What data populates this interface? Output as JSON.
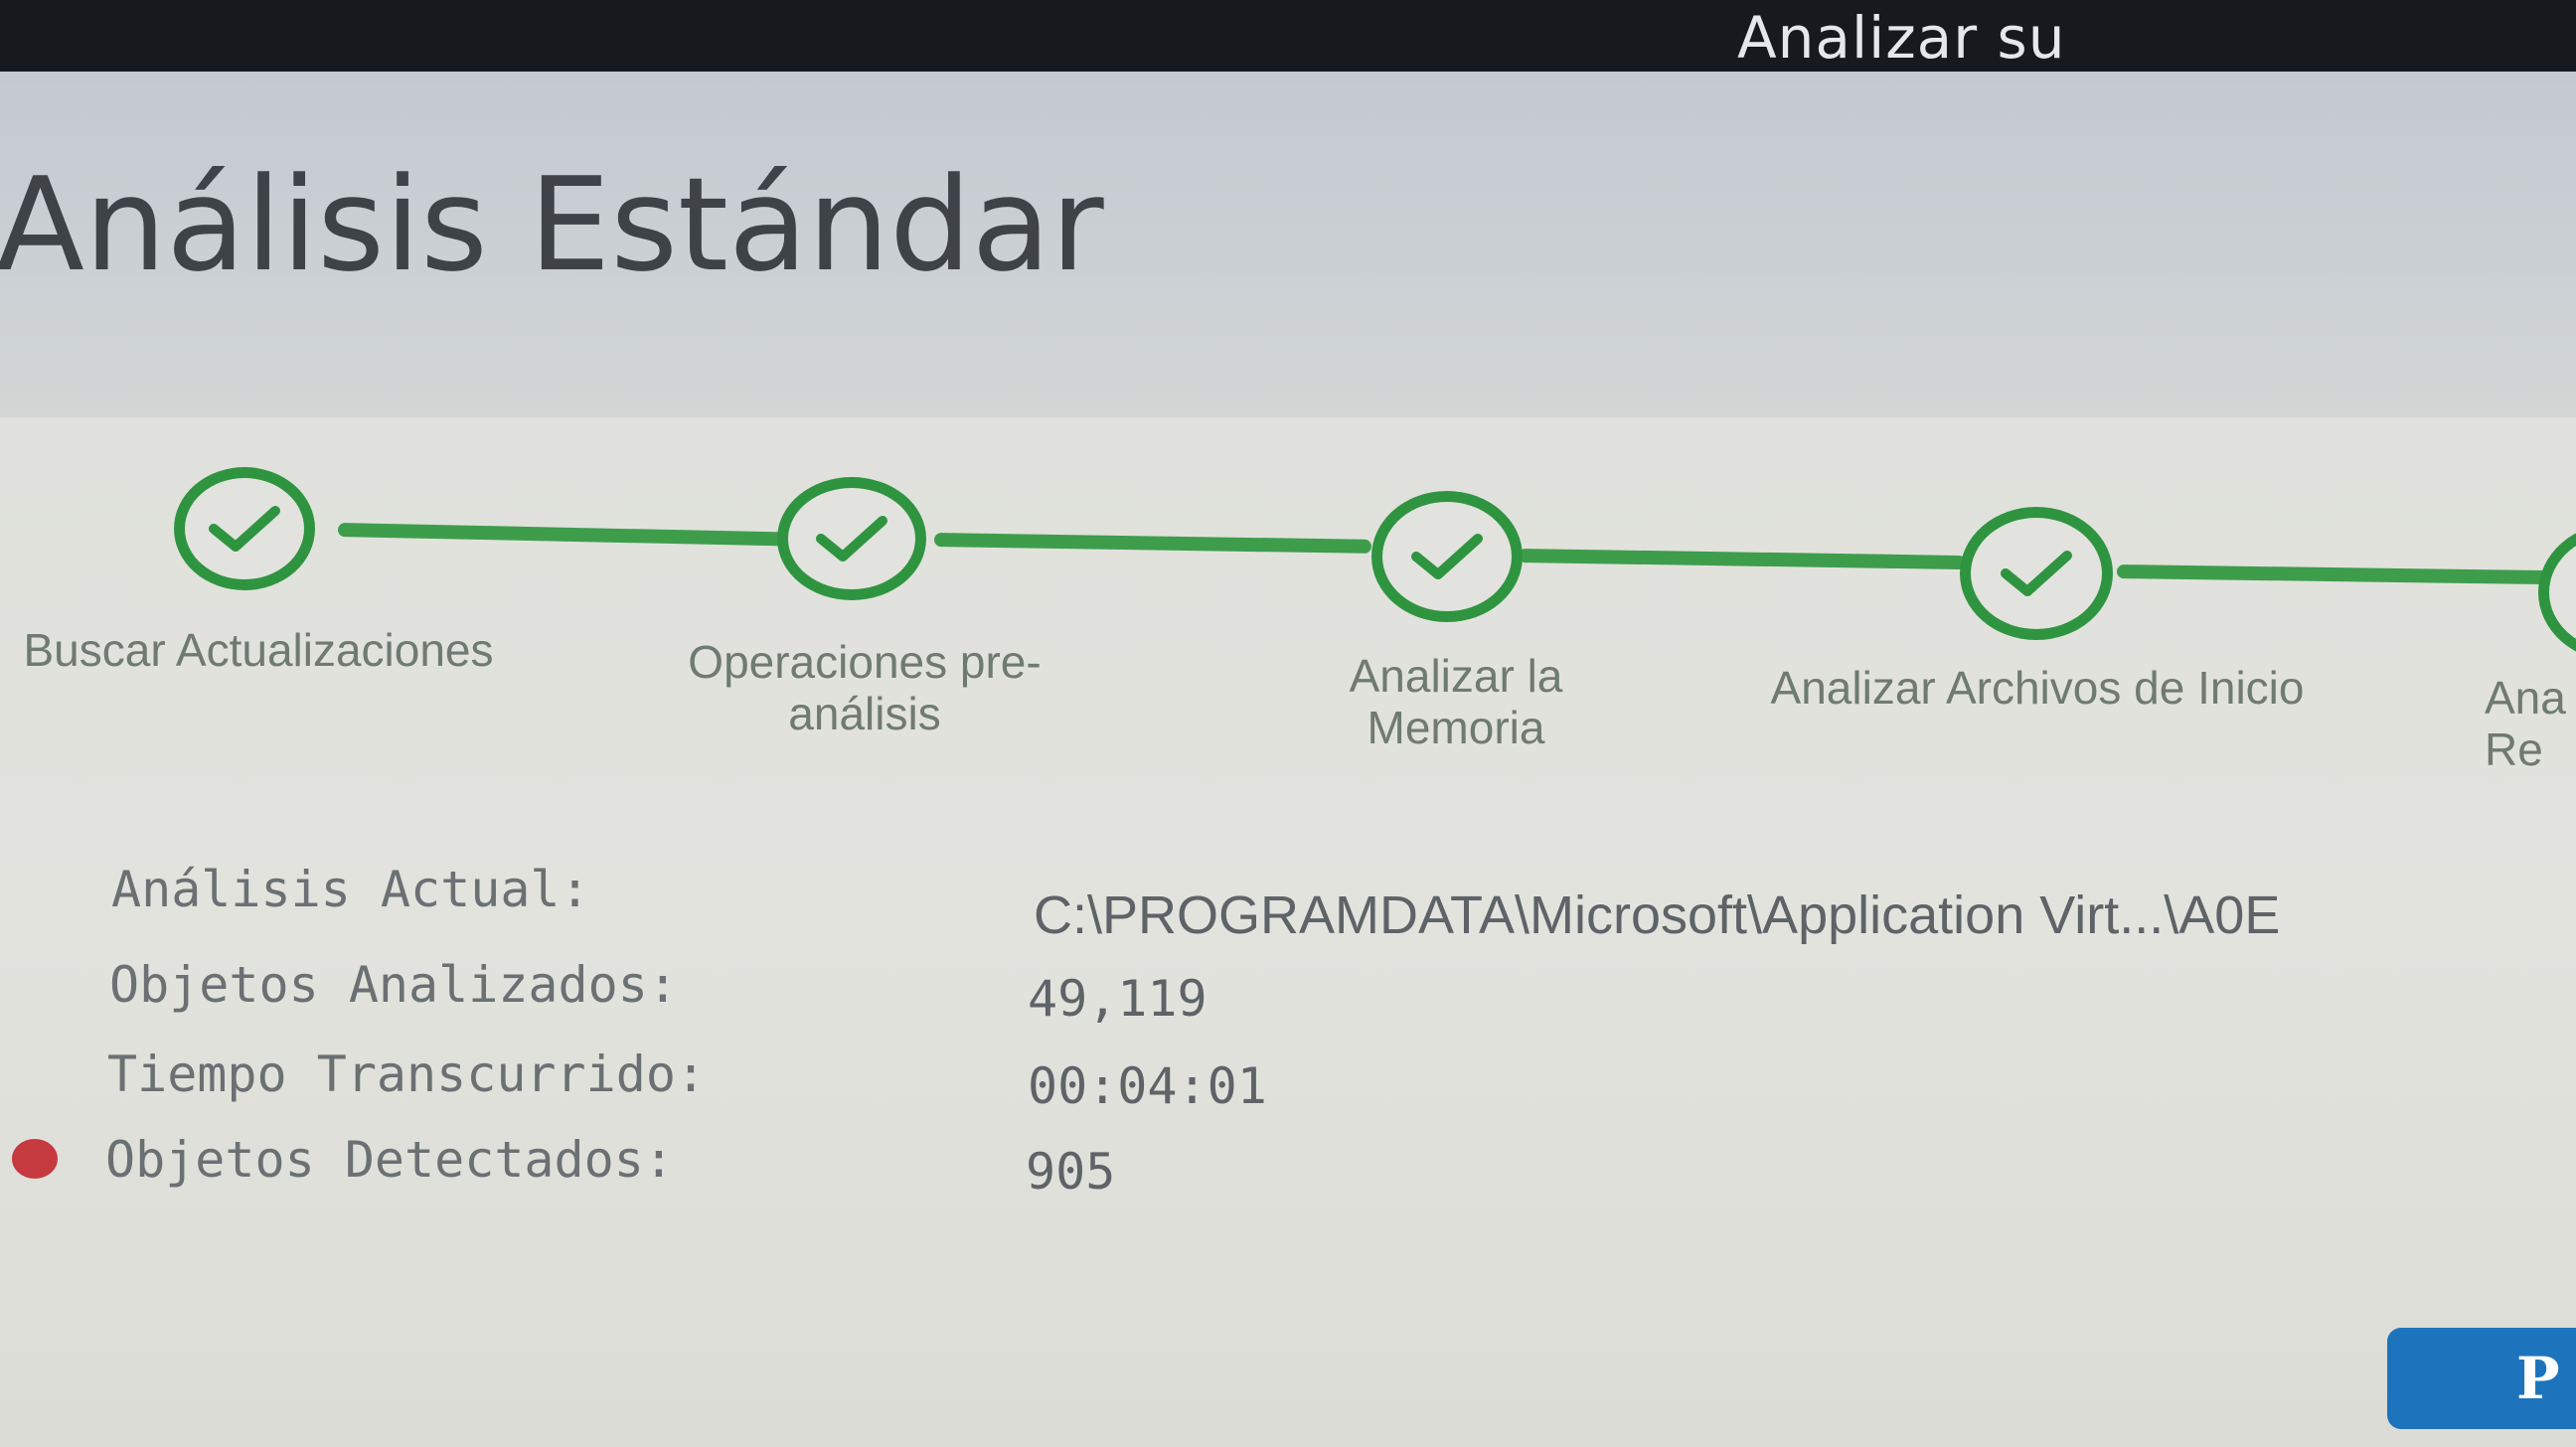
{
  "topbar": {
    "title": "Analizar su"
  },
  "page": {
    "title": "Análisis Estándar"
  },
  "steps": [
    {
      "label": "Buscar Actualizaciones",
      "status": "completed"
    },
    {
      "label": "Operaciones pre-análisis",
      "status": "completed"
    },
    {
      "label": "Analizar la Memoria",
      "status": "completed"
    },
    {
      "label": "Analizar Archivos de Inicio",
      "status": "completed"
    },
    {
      "label": "Ana Re",
      "status": "partially-visible"
    }
  ],
  "scan_info": {
    "current_label": "Análisis Actual:",
    "current_value": "C:\\PROGRAMDATA\\Microsoft\\Application Virt...\\A0E",
    "scanned_label": "Objetos Analizados:",
    "scanned_value": "49,119",
    "elapsed_label": "Tiempo Transcurrido:",
    "elapsed_value": "00:04:01",
    "detected_label": "Objetos Detectados:",
    "detected_value": "905"
  },
  "button": {
    "label": "P"
  },
  "colors": {
    "step_green": "#2f9440",
    "detected_dot": "#c43a3f",
    "button_blue": "#1d74bd",
    "topbar": "#161a1e"
  },
  "icons": {
    "step_complete": "checkmark-icon",
    "detected_marker": "red-dot-icon"
  }
}
